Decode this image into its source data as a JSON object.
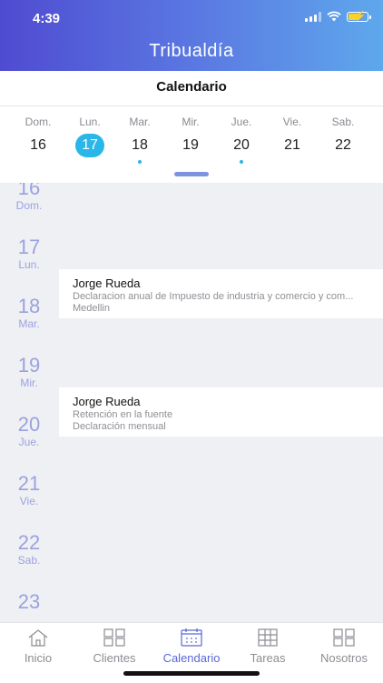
{
  "status_bar": {
    "time": "4:39"
  },
  "header": {
    "title": "Tribualdía"
  },
  "subheader": {
    "title": "Calendario"
  },
  "week": [
    {
      "name": "Dom.",
      "num": "16",
      "selected": false,
      "dot": false
    },
    {
      "name": "Lun.",
      "num": "17",
      "selected": true,
      "dot": false
    },
    {
      "name": "Mar.",
      "num": "18",
      "selected": false,
      "dot": true
    },
    {
      "name": "Mir.",
      "num": "19",
      "selected": false,
      "dot": false
    },
    {
      "name": "Jue.",
      "num": "20",
      "selected": false,
      "dot": true
    },
    {
      "name": "Vie.",
      "num": "21",
      "selected": false,
      "dot": false
    },
    {
      "name": "Sab.",
      "num": "22",
      "selected": false,
      "dot": false
    }
  ],
  "timeline": [
    {
      "num": "16",
      "name": "Dom."
    },
    {
      "num": "17",
      "name": "Lun."
    },
    {
      "num": "18",
      "name": "Mar."
    },
    {
      "num": "19",
      "name": "Mir."
    },
    {
      "num": "20",
      "name": "Jue."
    },
    {
      "num": "21",
      "name": "Vie."
    },
    {
      "num": "22",
      "name": "Sab."
    },
    {
      "num": "23",
      "name": ""
    }
  ],
  "events": [
    {
      "title": "Jorge Rueda",
      "line1": "Declaracion anual de Impuesto de industria y comercio y com...",
      "line2": "Medellin"
    },
    {
      "title": "Jorge Rueda",
      "line1": "Retención en la fuente",
      "line2": "Declaración mensual"
    }
  ],
  "tabs": [
    {
      "label": "Inicio",
      "icon": "home-icon",
      "active": false
    },
    {
      "label": "Clientes",
      "icon": "grid-icon",
      "active": false
    },
    {
      "label": "Calendario",
      "icon": "calendar-icon",
      "active": true
    },
    {
      "label": "Tareas",
      "icon": "tasks-icon",
      "active": false
    },
    {
      "label": "Nosotros",
      "icon": "grid-icon",
      "active": false
    }
  ],
  "colors": {
    "accent": "#29b6e8",
    "active_tab": "#5a67d8",
    "header_start": "#4f4bd1",
    "header_end": "#5ea8ec"
  }
}
